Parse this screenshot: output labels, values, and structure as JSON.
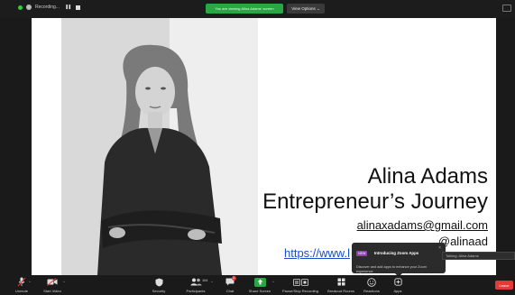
{
  "top_bar": {
    "recording_label": "Recording...",
    "viewing_banner": "You are viewing Alina Adams' screen",
    "view_options_label": "View Options ⌄"
  },
  "slide": {
    "name": "Alina Adams",
    "subtitle": "Entrepreneur’s Journey",
    "email": "alinaxadams@gmail.com",
    "handle": "@alinaad",
    "url": "https://www.l"
  },
  "popup": {
    "badge": "NEW",
    "title": "Introducing Zoom Apps",
    "body": "Discover and add apps to enhance your Zoom experience"
  },
  "talking_label": "Talking: Alina Adams",
  "toolbar": {
    "unmute": "Unmute",
    "start_video": "Start Video",
    "security": "Security",
    "participants": "Participants",
    "participants_count": "104",
    "chat": "Chat",
    "chat_badge": "3",
    "share_screen": "Share Screen",
    "pause_recording": "Pause/Stop Recording",
    "breakout_rooms": "Breakout Rooms",
    "reactions": "Reactions",
    "apps": "Apps",
    "leave": "Leave"
  },
  "colors": {
    "share_green": "#27a844",
    "leave_red": "#e53935",
    "link_blue": "#1a4fc4",
    "new_badge_purple": "#8e44ad"
  }
}
